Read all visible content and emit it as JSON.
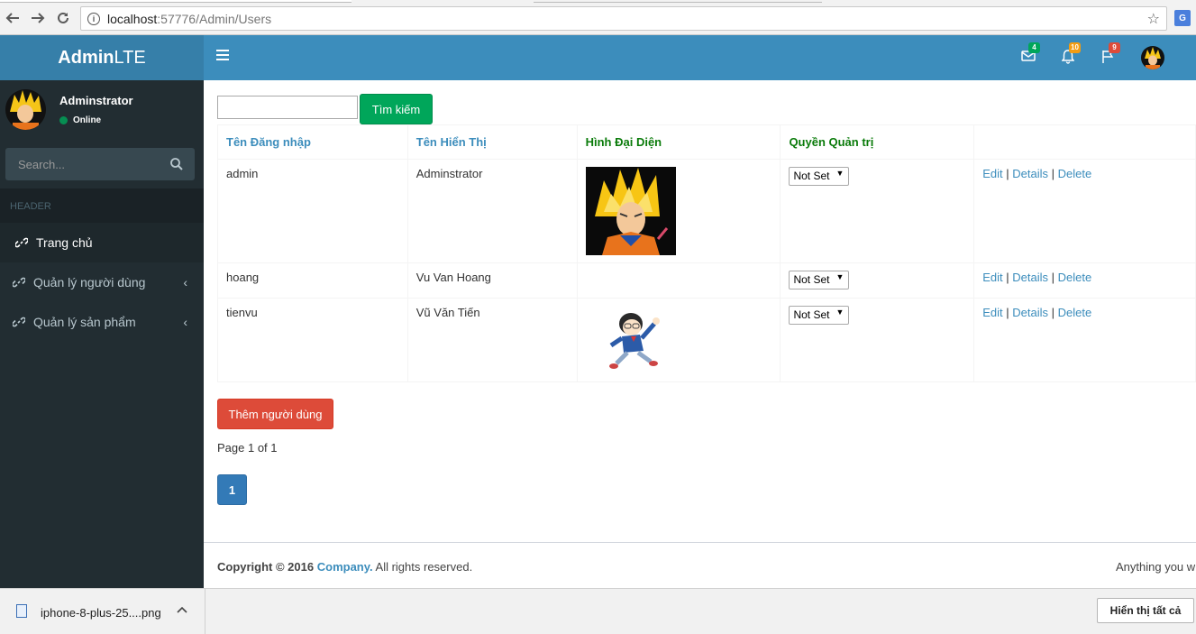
{
  "browser": {
    "url_host": "localhost",
    "url_rest": ":57776/Admin/Users",
    "translate_icon": "G"
  },
  "header": {
    "logo_bold": "Admin",
    "logo_light": "LTE",
    "messages_count": "4",
    "notifications_count": "10",
    "tasks_count": "9",
    "colors": {
      "logo_bg": "#367fa9",
      "nav_bg": "#3c8dbc"
    }
  },
  "sidebar": {
    "user_name": "Adminstrator",
    "user_status": "Online",
    "search_placeholder": "Search...",
    "section_header": "HEADER",
    "items": [
      {
        "label": "Trang chủ",
        "icon": "link-icon",
        "active": true
      },
      {
        "label": "Quản lý người dùng",
        "icon": "link-icon",
        "active": false
      },
      {
        "label": "Quản lý sản phẩm",
        "icon": "link-icon",
        "active": false
      }
    ]
  },
  "main": {
    "search_value": "",
    "search_button": "Tìm kiếm",
    "table": {
      "headers": [
        "Tên Đăng nhập",
        "Tên Hiển Thị",
        "Hình Đại Diện",
        "Quyền Quản trị",
        ""
      ],
      "rows": [
        {
          "username": "admin",
          "display_name": "Adminstrator",
          "avatar": "goku-avatar",
          "role": "Not Set"
        },
        {
          "username": "hoang",
          "display_name": "Vu Van Hoang",
          "avatar": "",
          "role": "Not Set"
        },
        {
          "username": "tienvu",
          "display_name": "Vũ Văn Tiến",
          "avatar": "conan-avatar",
          "role": "Not Set"
        }
      ],
      "actions": {
        "edit": "Edit",
        "details": "Details",
        "delete": "Delete",
        "separator": "|"
      }
    },
    "add_user_button": "Thêm người dùng",
    "page_info": "Page 1 of 1",
    "current_page": "1",
    "colors": {
      "search_btn": "#00a65a",
      "add_btn": "#dd4b39",
      "pager": "#337ab7",
      "link": "#3c8dbc"
    }
  },
  "footer": {
    "copyright_prefix": "Copyright © 2016",
    "company": "Company.",
    "rights": "All rights reserved.",
    "right_text": "Anything you w"
  },
  "download_bar": {
    "file_name": "iphone-8-plus-25....png",
    "show_all": "Hiển thị tất cả"
  }
}
